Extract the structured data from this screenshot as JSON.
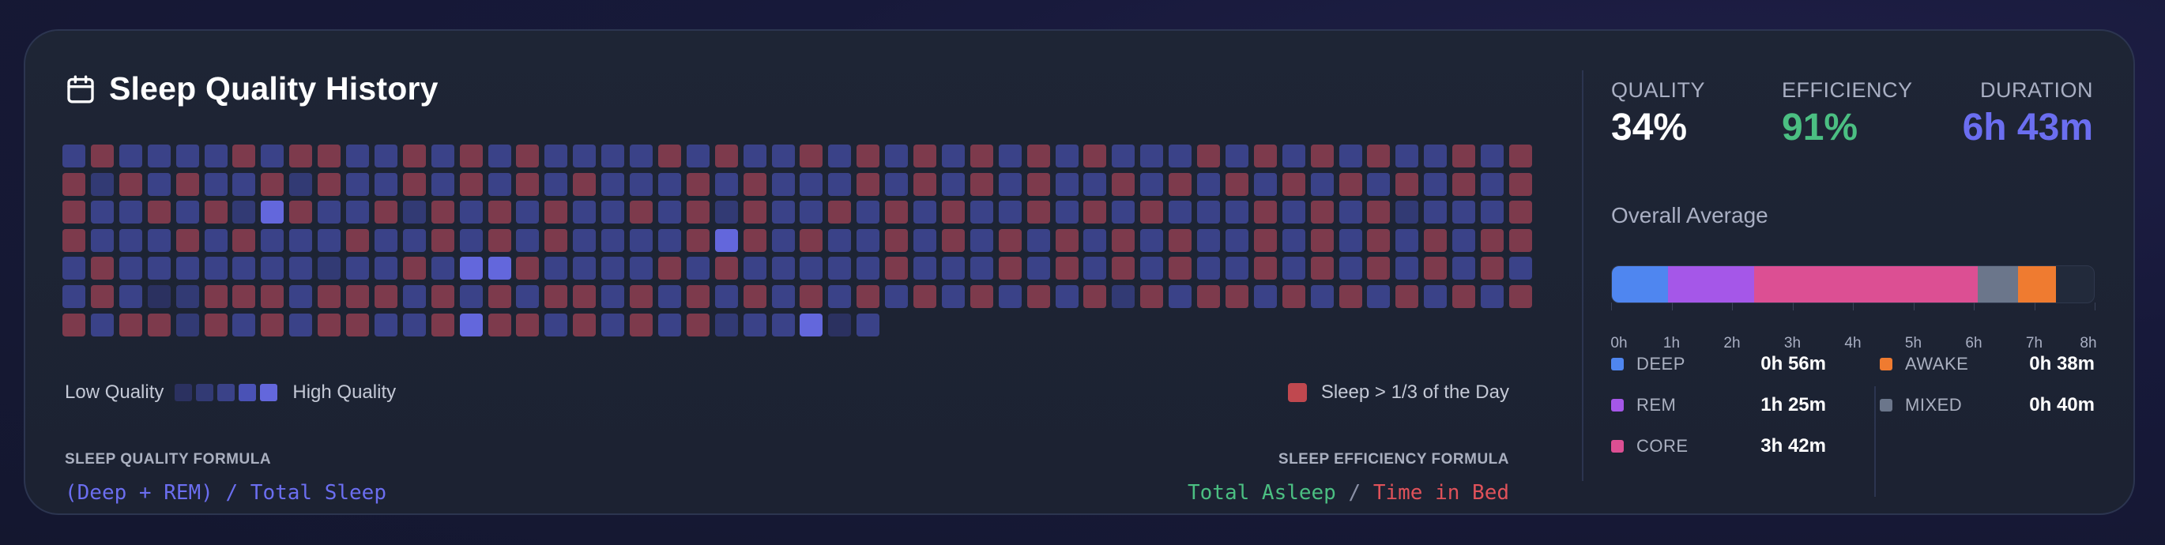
{
  "header": {
    "title": "Sleep Quality History",
    "icon": "calendar-icon"
  },
  "heatmap": {
    "rows": 7,
    "cols": 52,
    "palette": {
      "q0": "#2b3160",
      "q1": "#323a74",
      "q2": "#3a4288",
      "q3": "#4a52b6",
      "q4": "#6367dc",
      "over": "#7d3a4c"
    },
    "cells": [
      "3o3333o3oo33o3o3o3333o3o33o3o3o3o3o3o333o3o3o3o33o3o",
      "o2o3o33o2o33o3o3o3o333o3o333o3o3o3o33o3o3o3o3o3o3o3o",
      "o33o3o24o33o2o3o3o33o3o2o33o3o3o33o3o3o333o3o3o2333o",
      "o333o3o333o33o3o3o3333o4o3o33o3o3o3o3o3o33o3o3o3o3oo",
      "3o3333333233o344o3333o3o33333o333o3o3o3o33o3o3o3o3o3",
      "3o3 2ooo3ooo3o3o3oo3o3o3o3o3o3o3o3o3o2o3oo3o3o3o3o3o",
      "o3oo2o3o3oo33o4oo3o3o3o2334 3"
    ],
    "legend_low": "Low Quality",
    "legend_high": "High Quality",
    "legend_over": "Sleep > 1/3 of the Day"
  },
  "formulas": {
    "quality_label": "SLEEP QUALITY FORMULA",
    "quality_text": "(Deep + REM) / Total Sleep",
    "efficiency_label": "SLEEP EFFICIENCY FORMULA",
    "efficiency_asleep": "Total Asleep",
    "efficiency_sep": " / ",
    "efficiency_bed": "Time in Bed"
  },
  "stats": {
    "quality": {
      "label": "QUALITY",
      "value": "34%",
      "color": "#ffffff"
    },
    "efficiency": {
      "label": "EFFICIENCY",
      "value": "91%",
      "color": "#4bbf82"
    },
    "duration": {
      "label": "DURATION",
      "value": "6h 43m",
      "color": "#6b6ef0"
    }
  },
  "overall": {
    "label": "Overall Average",
    "axis_max_hours": 8,
    "ticks": [
      "0h",
      "1h",
      "2h",
      "3h",
      "4h",
      "5h",
      "6h",
      "7h",
      "8h"
    ],
    "segments": [
      {
        "name": "DEEP",
        "minutes": 56,
        "duration": "0h 56m",
        "color": "#4f86f0"
      },
      {
        "name": "REM",
        "minutes": 85,
        "duration": "1h 25m",
        "color": "#a557e8"
      },
      {
        "name": "CORE",
        "minutes": 222,
        "duration": "3h 42m",
        "color": "#dc4f93"
      },
      {
        "name": "MIXED",
        "minutes": 40,
        "duration": "0h 40m",
        "color": "#6b768b"
      },
      {
        "name": "AWAKE",
        "minutes": 38,
        "duration": "0h 38m",
        "color": "#ef7b30"
      }
    ]
  },
  "breakdown": {
    "left": [
      {
        "name": "DEEP",
        "duration": "0h 56m",
        "color": "#4f86f0"
      },
      {
        "name": "REM",
        "duration": "1h 25m",
        "color": "#a557e8"
      },
      {
        "name": "CORE",
        "duration": "3h 42m",
        "color": "#dc4f93"
      }
    ],
    "right": [
      {
        "name": "AWAKE",
        "duration": "0h 38m",
        "color": "#ef7b30"
      },
      {
        "name": "MIXED",
        "duration": "0h 40m",
        "color": "#6b768b"
      }
    ]
  }
}
